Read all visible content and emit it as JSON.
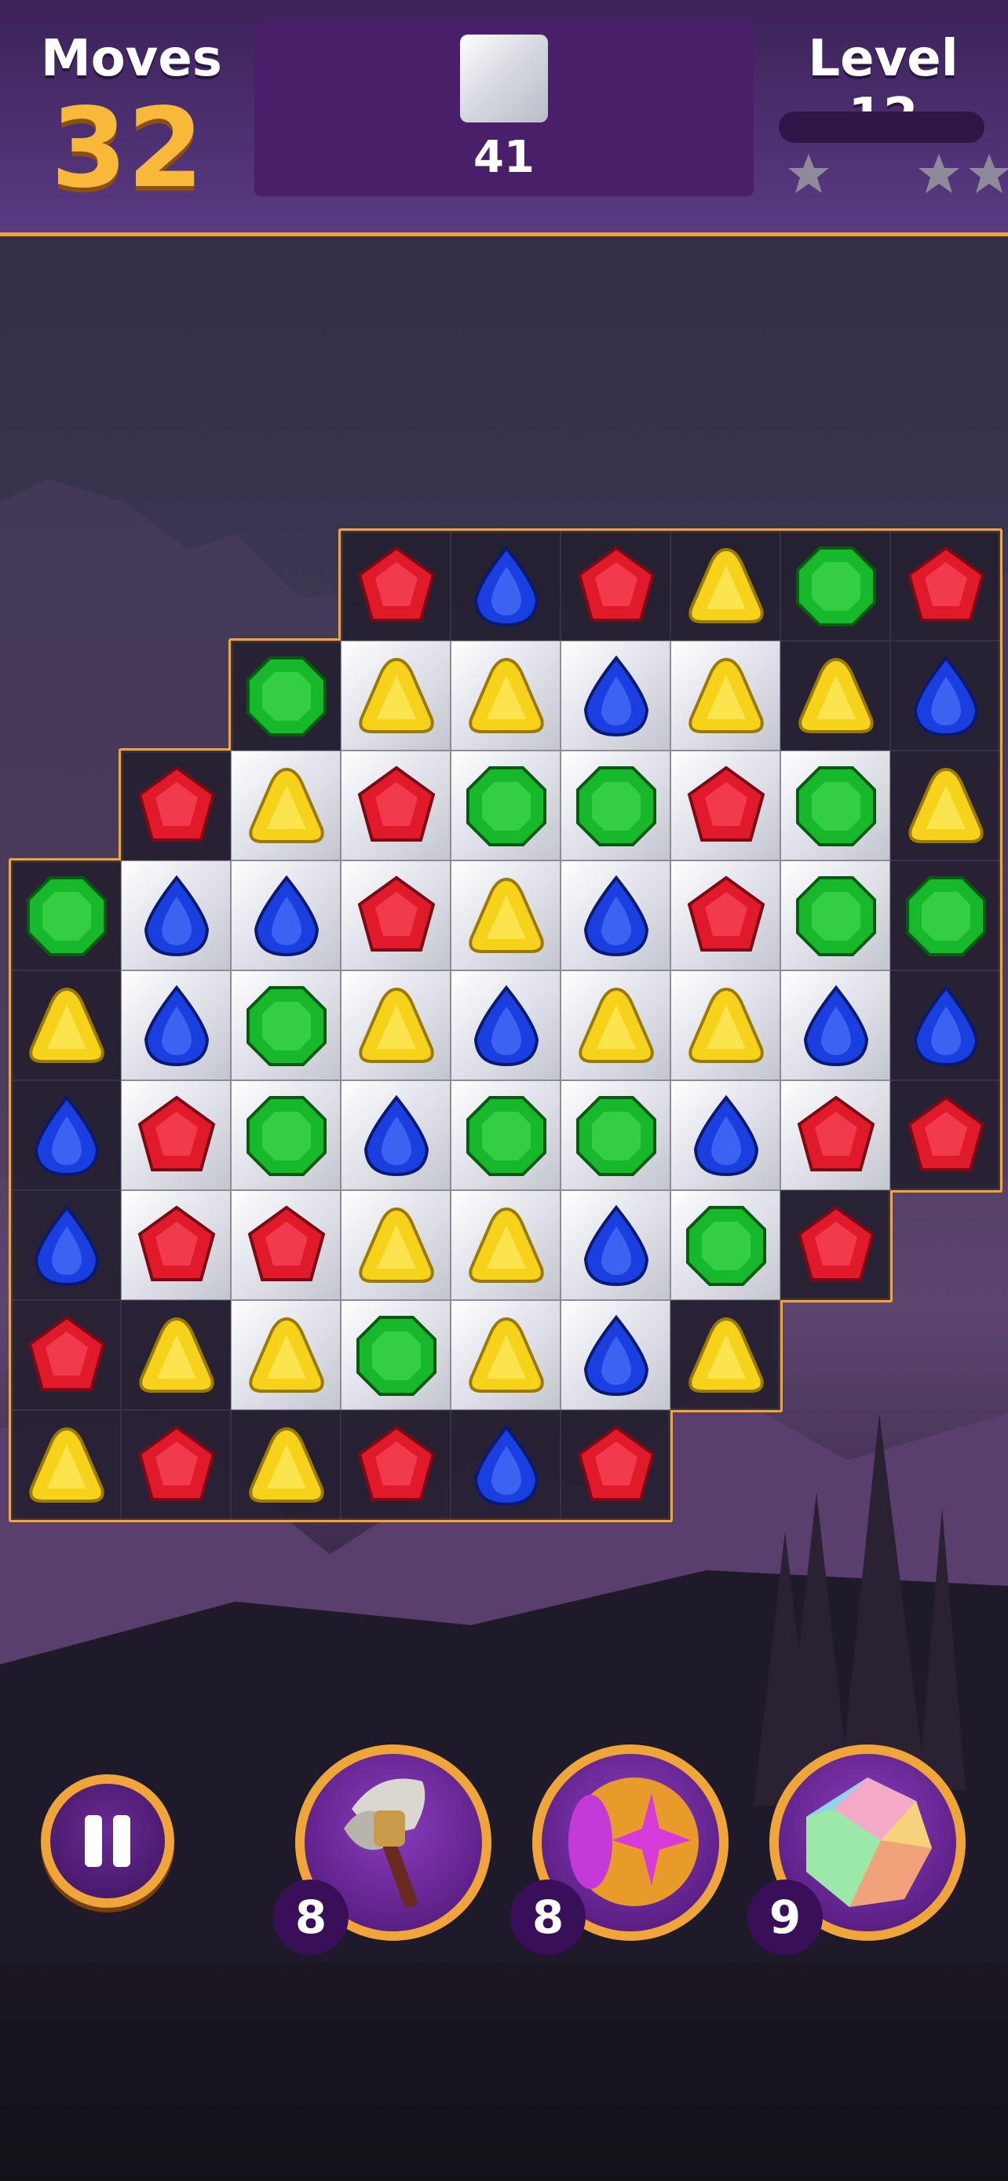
{
  "hud": {
    "moves_label": "Moves",
    "moves_value": "32",
    "goal_count": "41",
    "level_label": "Level 12",
    "level_progress": 0,
    "stars_earned": 0,
    "stars_total": 3
  },
  "colors": {
    "accent_orange": "#f0a53a",
    "hud_purple": "#4a1f6a",
    "red": "#e0192b",
    "blue": "#1a3fe0",
    "green": "#18b82c",
    "yellow": "#f6d21a"
  },
  "board": {
    "columns": 9,
    "rows": 9,
    "legend": "r=red gem, b=blue gem, g=green gem, y=yellow gem, .=no tile; uppercase cell = gem on marble blocker",
    "grid": [
      "...rbrygr",
      "..gYYBYyb",
      ".rYRGGRGy",
      "gBBRYBRGg",
      "yBGYBYYBb",
      "bRGBGGBRr",
      "bRRYYBGr.",
      "ryYGYBy..",
      "yryrbr..."
    ]
  },
  "controls": {
    "pause_icon": "pause-icon",
    "boosters": [
      {
        "icon": "hammer-icon",
        "count": "8"
      },
      {
        "icon": "star-orb-icon",
        "count": "8"
      },
      {
        "icon": "rainbow-gem-icon",
        "count": "9"
      }
    ]
  }
}
